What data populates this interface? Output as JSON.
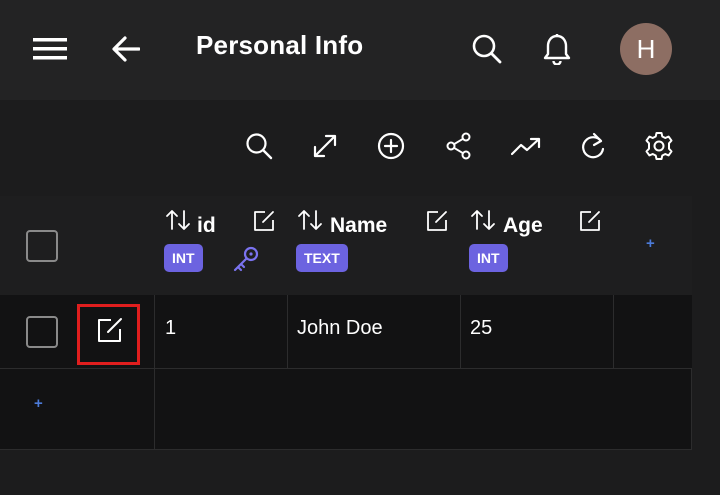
{
  "appbar": {
    "title": "Personal Info",
    "avatar_letter": "H",
    "icons": [
      "menu-icon",
      "arrow-left-icon",
      "search-icon",
      "bell-icon"
    ]
  },
  "toolbar": {
    "icons": [
      "search-icon",
      "expand-icon",
      "add-circle-icon",
      "share-icon",
      "trending-up-icon",
      "refresh-icon",
      "settings-icon"
    ]
  },
  "table": {
    "columns": [
      {
        "name": "id",
        "type": "INT",
        "primary_key": true
      },
      {
        "name": "Name",
        "type": "TEXT"
      },
      {
        "name": "Age",
        "type": "INT"
      }
    ],
    "add_column_label": "+",
    "rows": [
      {
        "id": "1",
        "Name": "John Doe",
        "Age": "25"
      }
    ],
    "add_row_label": "+"
  },
  "colors": {
    "accent": "#6c63e0",
    "link": "#4c7bd9",
    "highlight": "#e01e1e",
    "appbar": "#232324",
    "avatar": "#8d6e63"
  }
}
